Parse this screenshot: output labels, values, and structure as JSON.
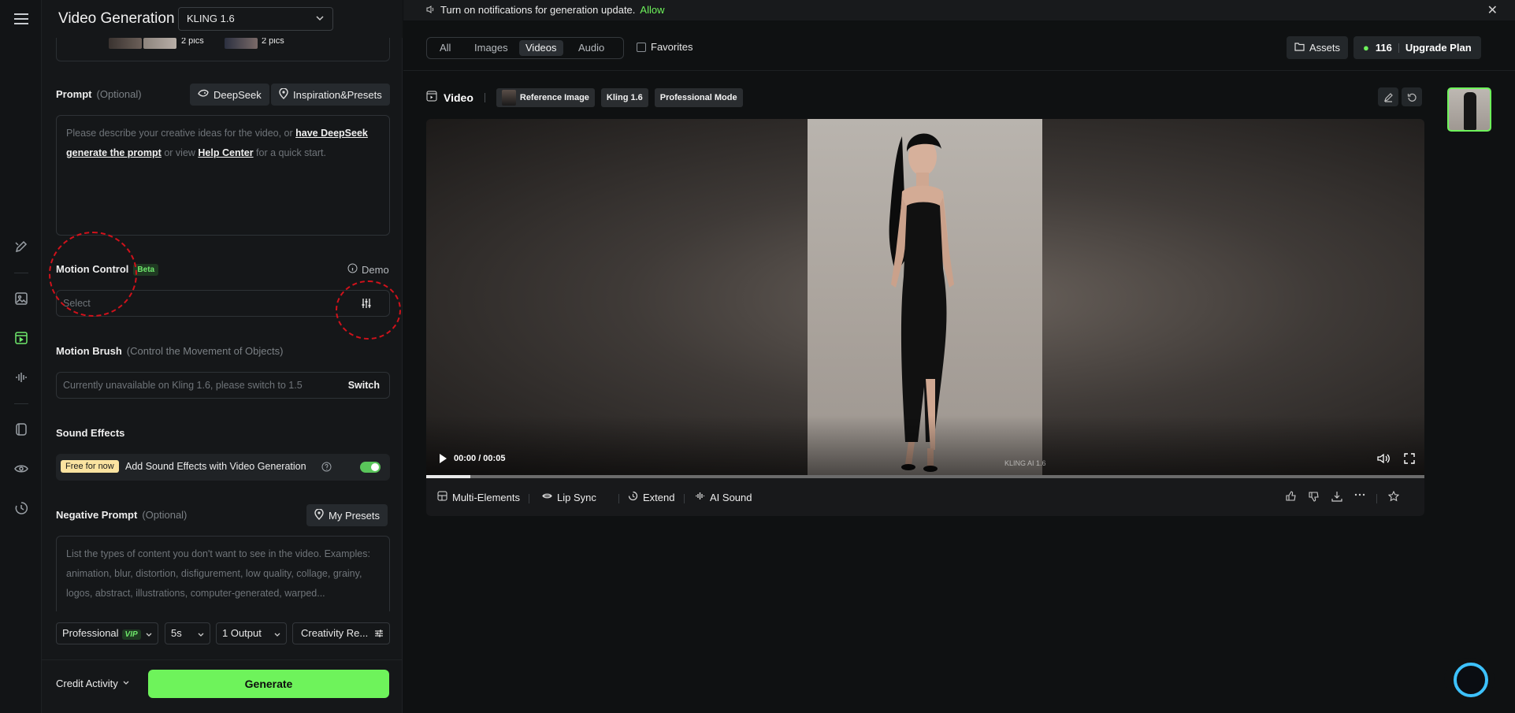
{
  "panel": {
    "title": "Video Generation",
    "model": "KLING 1.6",
    "thumbs": {
      "pics_a": "2 pics",
      "pics_b": "2 pics"
    },
    "prompt": {
      "label": "Prompt",
      "optional": "(Optional)",
      "deepseek": "DeepSeek",
      "inspiration": "Inspiration&Presets",
      "placeholder_pre": "Please describe your creative ideas for the video, or ",
      "link_deepseek_1": "have DeepSeek",
      "link_deepseek_2": "generate the prompt",
      "placeholder_mid": " or view ",
      "link_help": "Help Center",
      "placeholder_post": " for a quick start."
    },
    "motion_control": {
      "label": "Motion Control",
      "beta": "Beta",
      "demo": "Demo",
      "placeholder": "Select"
    },
    "motion_brush": {
      "label": "Motion Brush",
      "sub": "(Control the Movement of Objects)",
      "placeholder": "Currently unavailable on Kling 1.6, please switch to 1.5",
      "switch": "Switch"
    },
    "sound": {
      "label": "Sound Effects",
      "free": "Free for now",
      "text": "Add Sound Effects with Video Generation"
    },
    "negative": {
      "label": "Negative Prompt",
      "optional": "(Optional)",
      "presets": "My Presets",
      "placeholder": "List the types of content you don't want to see in the video. Examples: animation, blur, distortion, disfigurement, low quality, collage, grainy, logos, abstract, illustrations, computer-generated, warped..."
    },
    "options": {
      "mode": "Professional",
      "vip": "VIP",
      "duration": "5s",
      "outputs": "1 Output",
      "creativity": "Creativity Re..."
    },
    "footer": {
      "credit_activity": "Credit Activity",
      "generate": "Generate"
    }
  },
  "main": {
    "notice": {
      "text": "Turn on notifications for generation update.",
      "allow": "Allow"
    },
    "tabs": [
      "All",
      "Images",
      "Videos",
      "Audio"
    ],
    "active_tab": "Videos",
    "favorites": "Favorites",
    "assets": "Assets",
    "credits": "116",
    "upgrade": "Upgrade Plan",
    "video": {
      "title": "Video",
      "tags": [
        "Reference Image",
        "Kling 1.6",
        "Professional Mode"
      ],
      "time": "00:00 / 00:05",
      "progress": 0.044,
      "watermark": "KLING AI 1.6"
    },
    "actions": [
      "Multi-Elements",
      "Lip Sync",
      "Extend",
      "AI Sound"
    ]
  },
  "colors": {
    "accent": "#6ef35b",
    "annotation": "#d0121b"
  }
}
